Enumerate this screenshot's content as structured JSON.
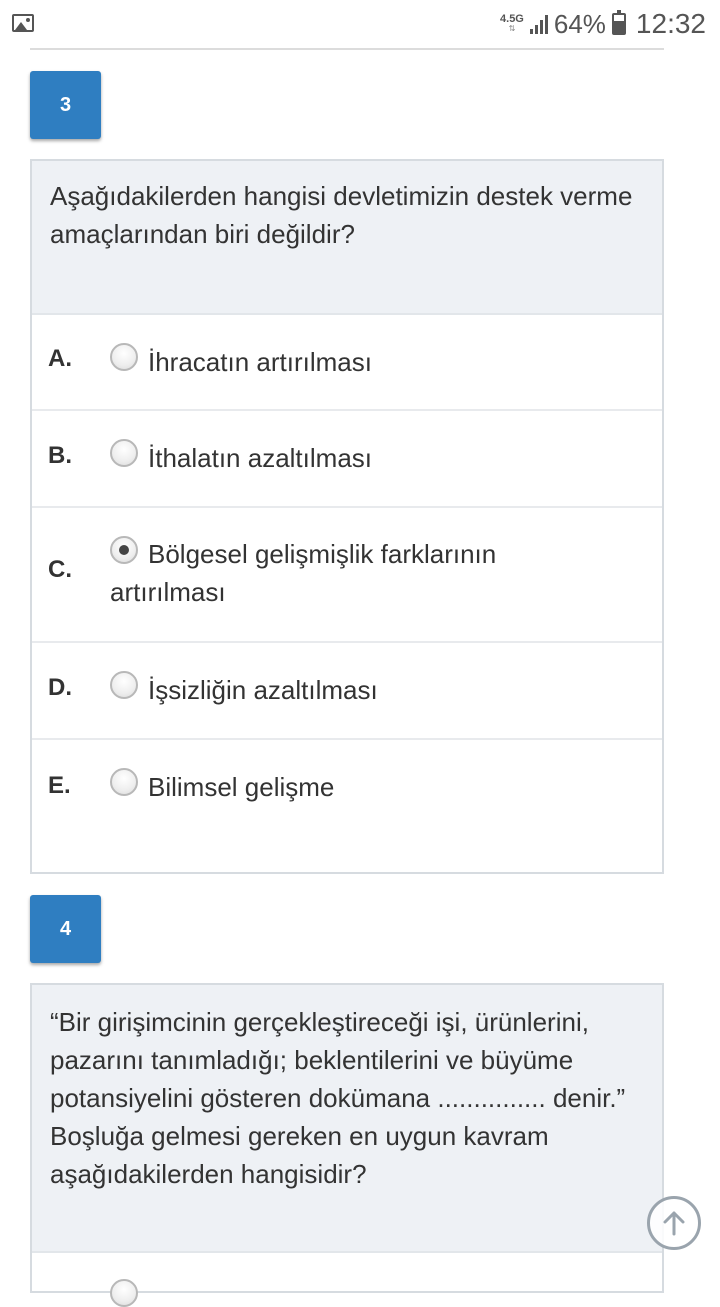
{
  "status_bar": {
    "network": "4.5G",
    "battery": "64%",
    "time": "12:32"
  },
  "questions": [
    {
      "number": "3",
      "text": "Aşağıdakilerden hangisi devletimizin destek verme amaçlarından biri değildir?",
      "options": [
        {
          "letter": "A.",
          "text": "İhracatın artırılması",
          "selected": false
        },
        {
          "letter": "B.",
          "text": "İthalatın azaltılması",
          "selected": false
        },
        {
          "letter": "C.",
          "text": "Bölgesel gelişmişlik farklarının artırılması",
          "selected": true
        },
        {
          "letter": "D.",
          "text": "İşsizliğin azaltılması",
          "selected": false
        },
        {
          "letter": "E.",
          "text": "Bilimsel gelişme",
          "selected": false
        }
      ]
    },
    {
      "number": "4",
      "text": "“Bir girişimcinin gerçekleştireceği işi, ürünlerini, pazarını tanımladığı; beklentilerini ve büyüme potansiyelini gösteren dokümana ............... denir.” Boşluğa gelmesi gereken en uygun kavram aşağıdakilerden hangisidir?"
    }
  ]
}
